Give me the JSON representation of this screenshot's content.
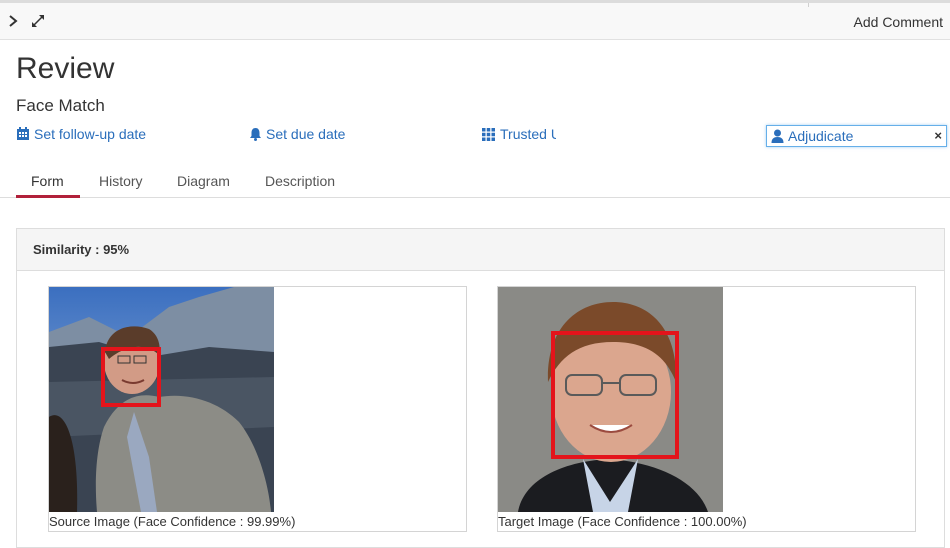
{
  "toolbar": {
    "collapse_icon": "chevron-right-icon",
    "expand_icon": "expand-arrows-icon",
    "add_comment_label": "Add Comment"
  },
  "header": {
    "title": "Review",
    "subtitle": "Face Match"
  },
  "actions": {
    "follow_up": {
      "label": "Set follow-up date",
      "icon": "calendar-icon"
    },
    "due_date": {
      "label": "Set due date",
      "icon": "bell-icon"
    },
    "group": {
      "label": "Trusted Users",
      "icon": "grid-icon"
    },
    "assignee": {
      "label": "Adjudicate",
      "icon": "user-icon",
      "clear": "×"
    }
  },
  "tabs": [
    "Form",
    "History",
    "Diagram",
    "Description"
  ],
  "active_tab": "Form",
  "form": {
    "similarity_label": "Similarity : 95%",
    "similarity_value": 95,
    "source": {
      "caption": "Source Image (Face Confidence : 99.99%)",
      "confidence": 99.99
    },
    "target": {
      "caption": "Target Image (Face Confidence : 100.00%)",
      "confidence": 100.0
    }
  },
  "colors": {
    "link": "#2a6ebb",
    "tab_active": "#b1203a",
    "face_box": "#e4141b",
    "panel_header": "#f5f5f5"
  }
}
